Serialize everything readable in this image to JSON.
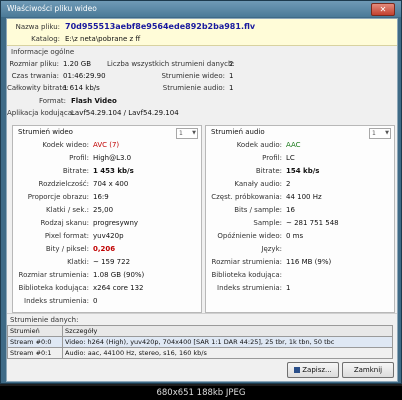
{
  "window": {
    "title": "Właściwości pliku wideo",
    "close": "✕"
  },
  "file": {
    "name_label": "Nazwa pliku:",
    "name_value": "70d955513aebf8e9564ede892b2ba981.flv",
    "dir_label": "Katalog:",
    "dir_value": "E:\\z neta\\pobrane z ff"
  },
  "general": {
    "title": "Informacje ogólne",
    "size_label": "Rozmiar pliku:",
    "size_value": "1.20 GB",
    "duration_label": "Czas trwania:",
    "duration_value": "01:46:29.90",
    "bitrate_label": "Całkowity bitrate:",
    "bitrate_value": "1 614 kb/s",
    "format_label": "Format:",
    "format_value": "Flash Video",
    "app_label": "Aplikacja kodująca:",
    "app_value": "Lavf54.29.104 / Lavf54.29.104",
    "streams_label": "Liczba wszystkich strumieni danych:",
    "streams_value": "2",
    "video_streams_label": "Strumienie wideo:",
    "video_streams_value": "1",
    "audio_streams_label": "Strumienie audio:",
    "audio_streams_value": "1"
  },
  "video": {
    "title": "Strumień wideo",
    "combo": "1",
    "rows": [
      {
        "label": "Kodek wideo:",
        "value": "AVC (7)"
      },
      {
        "label": "Profil:",
        "value": "High@L3.0"
      },
      {
        "label": "Bitrate:",
        "value": "1 453 kb/s"
      },
      {
        "label": "Rozdzielczość:",
        "value": "704 x 400"
      },
      {
        "label": "Proporcje obrazu:",
        "value": "16:9"
      },
      {
        "label": "Klatki / sek.:",
        "value": "25,00"
      },
      {
        "label": "Rodzaj skanu:",
        "value": "progresywny"
      },
      {
        "label": "Pixel format:",
        "value": "yuv420p"
      },
      {
        "label": "Bity / piksel:",
        "value": "0,206"
      },
      {
        "label": "Klatki:",
        "value": "~ 159 722"
      },
      {
        "label": "Rozmiar strumienia:",
        "value": "1.08 GB (90%)"
      },
      {
        "label": "Biblioteka kodująca:",
        "value": "x264 core 132"
      },
      {
        "label": "Indeks strumienia:",
        "value": "0"
      }
    ]
  },
  "audio": {
    "title": "Strumień audio",
    "combo": "1",
    "rows": [
      {
        "label": "Kodek audio:",
        "value": "AAC"
      },
      {
        "label": "Profil:",
        "value": "LC"
      },
      {
        "label": "Bitrate:",
        "value": "154 kb/s"
      },
      {
        "label": "Kanały audio:",
        "value": "2"
      },
      {
        "label": "Częst. próbkowania:",
        "value": "44 100 Hz"
      },
      {
        "label": "Bits / sample:",
        "value": "16"
      },
      {
        "label": "Sample:",
        "value": "~ 281 751 548"
      },
      {
        "label": "Opóźnienie wideo:",
        "value": "0 ms"
      },
      {
        "label": "Język:",
        "value": ""
      },
      {
        "label": "Rozmiar strumienia:",
        "value": "116 MB (9%)"
      },
      {
        "label": "Biblioteka kodująca:",
        "value": ""
      },
      {
        "label": "Indeks strumienia:",
        "value": "1"
      }
    ]
  },
  "stream_data": {
    "title": "Strumienie danych:",
    "headers": [
      "Strumień",
      "Szczegóły"
    ],
    "rows": [
      [
        "Stream #0:0",
        "Video: h264 (High), yuv420p, 704x400 [SAR 1:1 DAR 44:25], 25 tbr, 1k tbn, 50 tbc"
      ],
      [
        "Stream #0:1",
        "Audio: aac, 44100 Hz, stereo, s16, 160 kb/s"
      ]
    ]
  },
  "buttons": {
    "save": "Zapisz...",
    "close": "Zamknij"
  },
  "footer": "680x651  188kb  JPEG"
}
